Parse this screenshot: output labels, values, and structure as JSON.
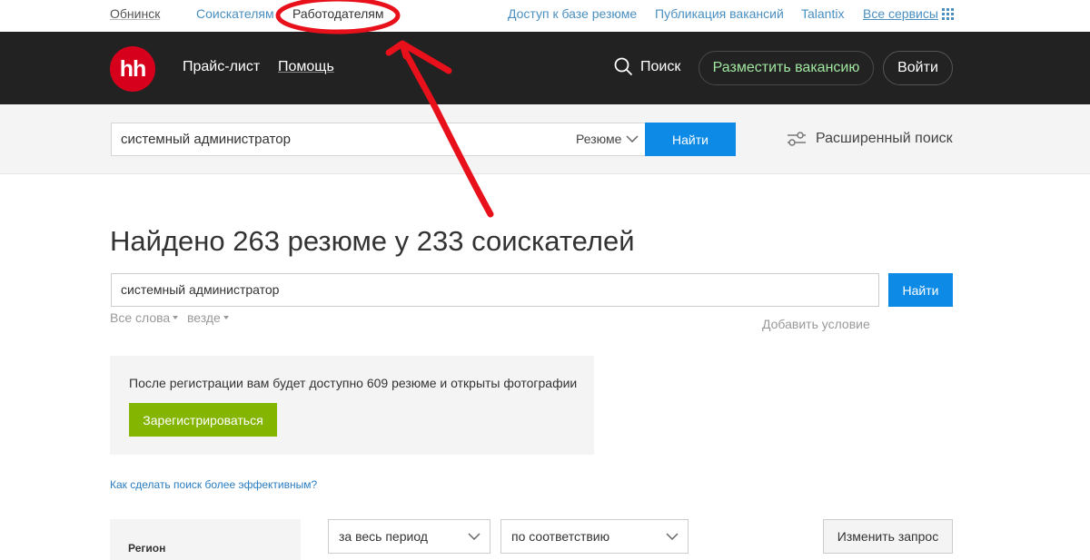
{
  "topbar": {
    "city": "Обнинск",
    "seekers": "Соискателям",
    "employers": "Работодателям",
    "resume_db": "Доступ к базе резюме",
    "publish": "Публикация вакансий",
    "talantix": "Talantix",
    "all_services": "Все сервисы"
  },
  "header": {
    "logo": "hh",
    "price_list": "Прайс-лист",
    "help": "Помощь",
    "search": "Поиск",
    "post_vacancy": "Разместить вакансию",
    "login": "Войти"
  },
  "search_band": {
    "query": "системный администратор",
    "type": "Резюме",
    "find": "Найти",
    "advanced": "Расширенный поиск"
  },
  "main": {
    "title": "Найдено 263 резюме у 233 соискателей",
    "query": "системный администратор",
    "find": "Найти",
    "all_words": "Все слова",
    "everywhere": "везде",
    "add_condition": "Добавить условие"
  },
  "registration": {
    "text": "После регистрации вам будет доступно 609 резюме и открыты фотографии",
    "button": "Зарегистрироваться"
  },
  "help_link": "Как сделать поиск более эффективным?",
  "filters": {
    "region_label": "Регион",
    "period": "за весь период",
    "sort": "по соответствию",
    "change_query": "Изменить запрос"
  },
  "colors": {
    "header_bg": "#222222",
    "brand_red": "#d6001c",
    "primary_blue": "#0d8ae6",
    "register_green": "#84b500",
    "annotation_red": "#e8101a"
  }
}
